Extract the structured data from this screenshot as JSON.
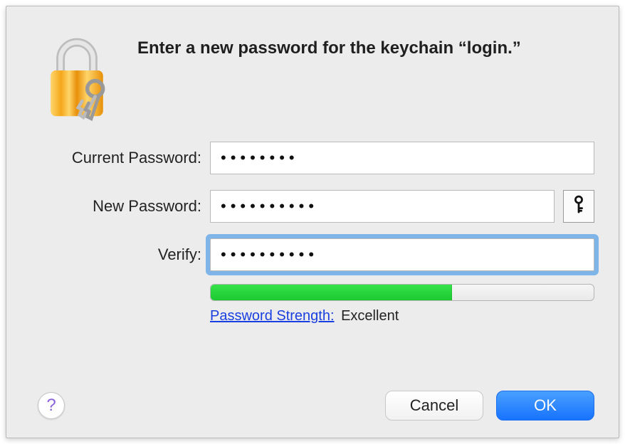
{
  "dialog": {
    "title": "Enter a new password for the keychain “login.”",
    "icon": "keychain-lock-icon"
  },
  "fields": {
    "current": {
      "label": "Current Password:",
      "value": "••••••••"
    },
    "new": {
      "label": "New Password:",
      "value": "••••••••••"
    },
    "verify": {
      "label": "Verify:",
      "value": "••••••••••",
      "focused": true
    }
  },
  "key_button": {
    "icon": "key-icon"
  },
  "strength": {
    "label": "Password Strength:",
    "value": "Excellent",
    "percent": 63,
    "fill_color": "#29d83b"
  },
  "footer": {
    "help_icon": "help-icon",
    "cancel_label": "Cancel",
    "ok_label": "OK"
  },
  "colors": {
    "dialog_bg": "#ececec",
    "link": "#1a3fe0",
    "primary_start": "#4aa0ff",
    "primary_end": "#1773ff",
    "focus_ring": "#6caae8"
  }
}
